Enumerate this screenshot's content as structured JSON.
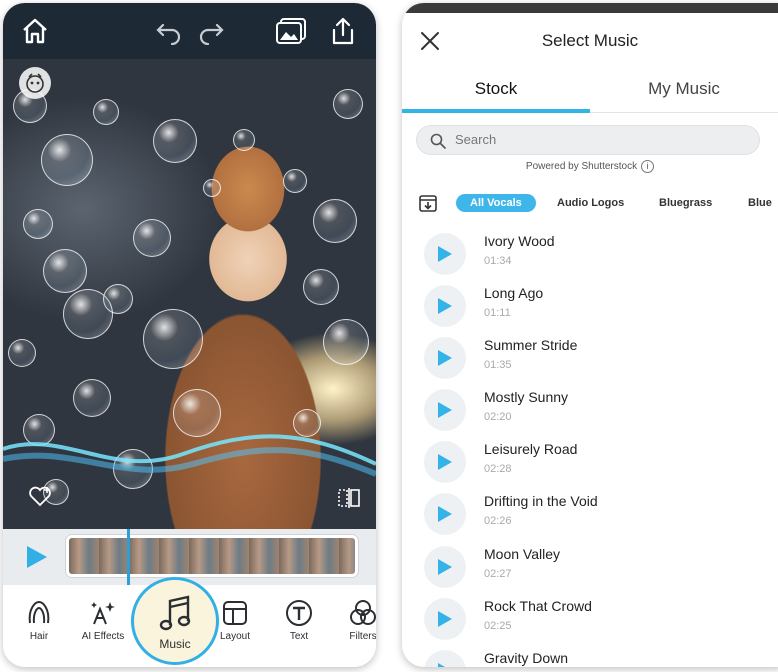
{
  "left_phone": {
    "toolbar": [
      {
        "label": "Hair",
        "icon": "hair-icon"
      },
      {
        "label": "AI Effects",
        "icon": "ai-effects-icon"
      },
      {
        "label": "Music",
        "icon": "music-note-icon",
        "active": true
      },
      {
        "label": "Layout",
        "icon": "layout-icon"
      },
      {
        "label": "Text",
        "icon": "text-icon"
      },
      {
        "label": "Filters",
        "icon": "filters-icon"
      }
    ]
  },
  "right_phone": {
    "title": "Select Music",
    "tabs": [
      {
        "label": "Stock",
        "active": true
      },
      {
        "label": "My Music",
        "active": false
      }
    ],
    "search": {
      "placeholder": "Search"
    },
    "powered_by": "Powered by Shutterstock",
    "info_glyph": "i",
    "chips": [
      {
        "label": "All Vocals",
        "active": true
      },
      {
        "label": "Audio Logos",
        "active": false
      },
      {
        "label": "Bluegrass",
        "active": false
      },
      {
        "label": "Blue",
        "active": false
      }
    ],
    "songs": [
      {
        "name": "Ivory Wood",
        "duration": "01:34"
      },
      {
        "name": "Long Ago",
        "duration": "01:11"
      },
      {
        "name": "Summer Stride",
        "duration": "01:35"
      },
      {
        "name": "Mostly Sunny",
        "duration": "02:20"
      },
      {
        "name": "Leisurely Road",
        "duration": "02:28"
      },
      {
        "name": "Drifting in the Void",
        "duration": "02:26"
      },
      {
        "name": "Moon Valley",
        "duration": "02:27"
      },
      {
        "name": "Rock That Crowd",
        "duration": "02:25"
      },
      {
        "name": "Gravity Down",
        "duration": ""
      }
    ]
  },
  "colors": {
    "accent": "#33b3e8",
    "music_highlight": "#fbf4dc",
    "topbar": "#1d2a36"
  }
}
